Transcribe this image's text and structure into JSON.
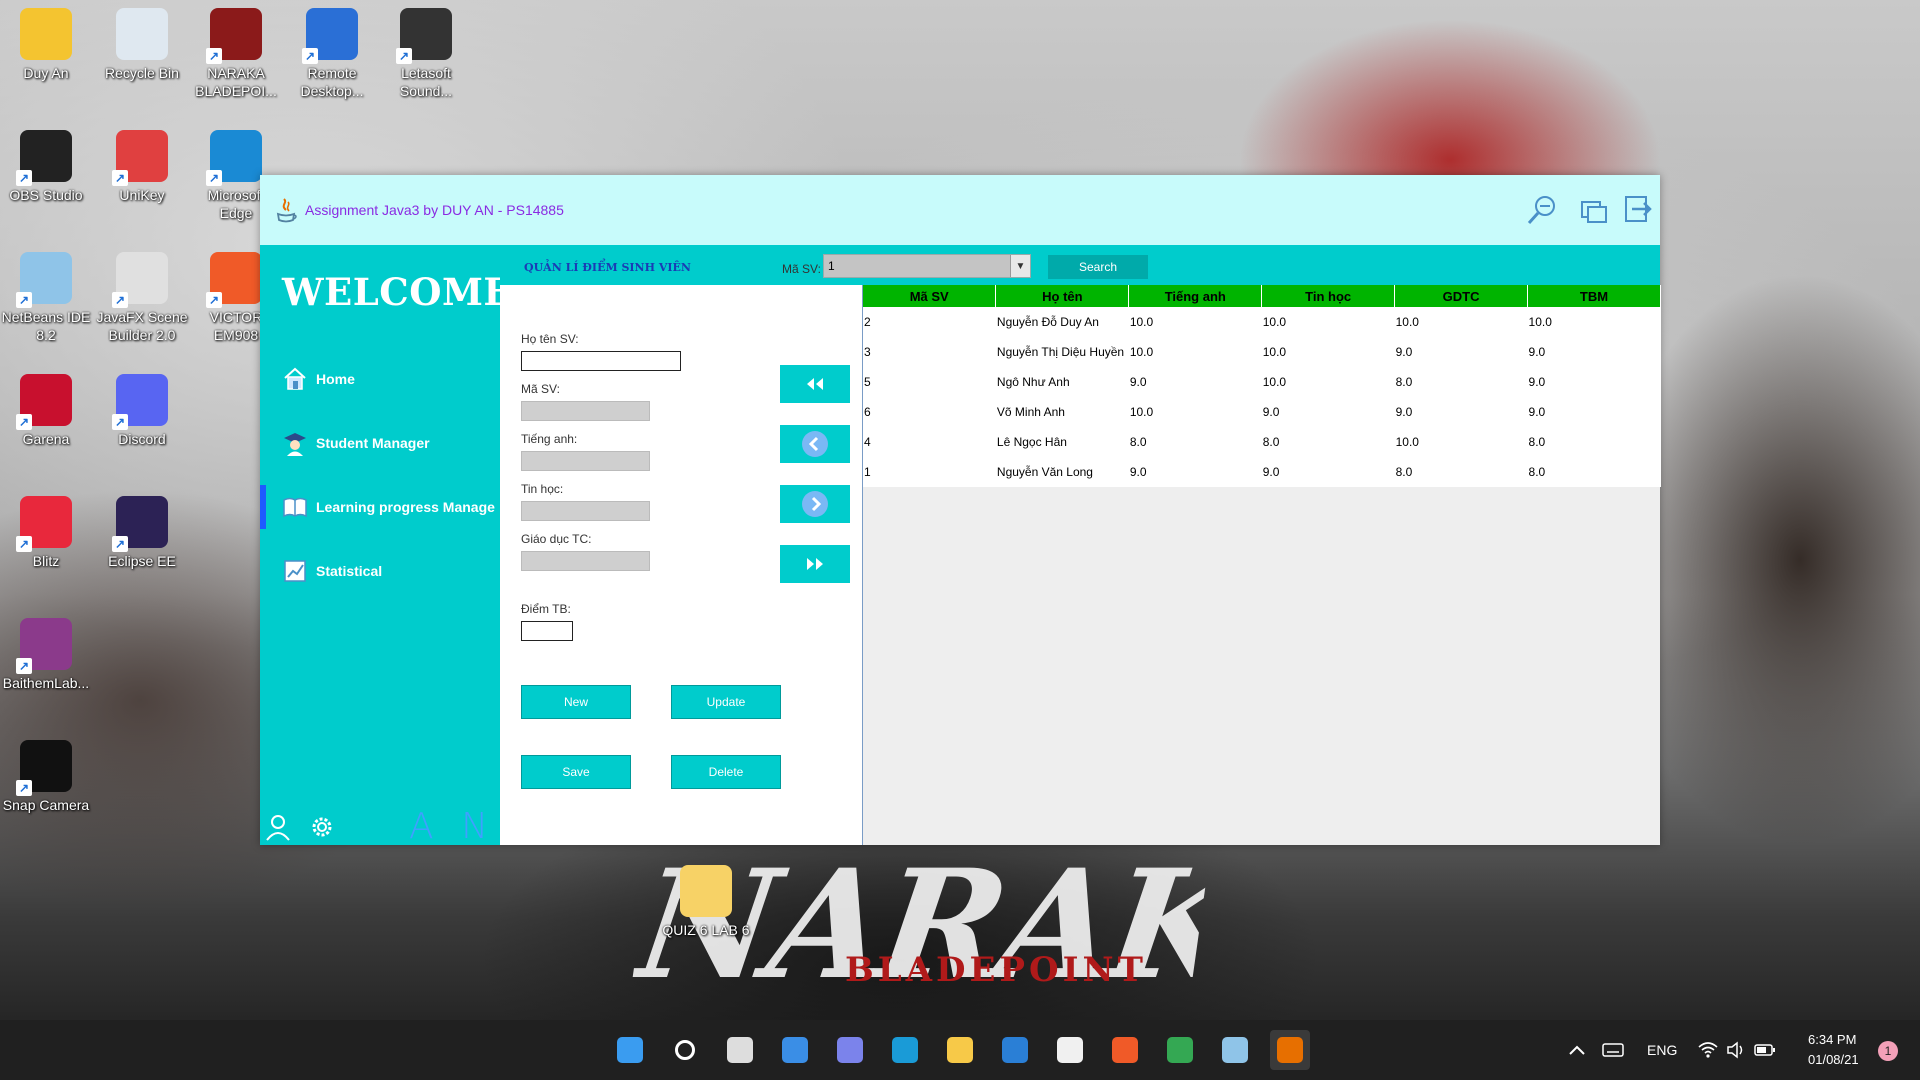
{
  "desktop": {
    "icons": [
      {
        "label": "Duy An",
        "icon": "user-folder-icon",
        "color": "#f4c430"
      },
      {
        "label": "Recycle Bin",
        "icon": "recycle-bin-icon",
        "color": "#dfe8f0"
      },
      {
        "label": "NARAKA BLADEPOI...",
        "icon": "naraka-game-icon",
        "color": "#8b1a1a"
      },
      {
        "label": "Remote Desktop...",
        "icon": "remote-desktop-icon",
        "color": "#2a6fd6"
      },
      {
        "label": "Letasoft Sound...",
        "icon": "speaker-icon",
        "color": "#333333"
      },
      {
        "label": "OBS Studio",
        "icon": "obs-icon",
        "color": "#222222"
      },
      {
        "label": "UniKey",
        "icon": "unikey-icon",
        "color": "#e04040"
      },
      {
        "label": "Microsoft Edge",
        "icon": "edge-icon",
        "color": "#1a8ad4"
      },
      {
        "label": "NetBeans IDE 8.2",
        "icon": "netbeans-icon",
        "color": "#8fc4e8"
      },
      {
        "label": "JavaFX Scene Builder 2.0",
        "icon": "hand-cursor-icon",
        "color": "#e0e0e0"
      },
      {
        "label": "VICTOR EM908",
        "icon": "victor-icon",
        "color": "#f05a28"
      },
      {
        "label": "Garena",
        "icon": "garena-icon",
        "color": "#c8102e"
      },
      {
        "label": "Discord",
        "icon": "discord-icon",
        "color": "#5865f2"
      },
      {
        "label": "Blitz",
        "icon": "blitz-icon",
        "color": "#e8283c"
      },
      {
        "label": "Eclipse EE",
        "icon": "eclipse-icon",
        "color": "#2c2255"
      },
      {
        "label": "BaithemLab...",
        "icon": "winrar-icon",
        "color": "#8b3a8b"
      },
      {
        "label": "Snap Camera",
        "icon": "snap-camera-icon",
        "color": "#111111"
      },
      {
        "label": "QUIZ 6 LAB 6",
        "icon": "folder-icon",
        "color": "#f7d266"
      }
    ],
    "wallpaper_title": "NARAKA",
    "wallpaper_subtitle": "BLADEPOINT"
  },
  "window": {
    "title": "Assignment Java3 by DUY AN - PS14885",
    "title_color": "#8a2be2",
    "titlebar_color": "#c8fbfb",
    "accent": "#00cccc",
    "titlebar_buttons": [
      "zoom-out-icon",
      "restore-window-icon",
      "exit-icon"
    ]
  },
  "sidebar": {
    "welcome": "WELCOME",
    "items": [
      {
        "label": "Home",
        "icon": "home-icon",
        "active": false
      },
      {
        "label": "Student Manager",
        "icon": "student-icon",
        "active": false
      },
      {
        "label": "Learning progress Manage",
        "icon": "book-icon",
        "active": true
      },
      {
        "label": "Statistical",
        "icon": "chart-icon",
        "active": false
      }
    ],
    "footer_text": "A N"
  },
  "header": {
    "module_title": "QUẢN LÍ ĐIỂM SINH VIÊN",
    "masv_label": "Mã SV:",
    "masv_selected": "1",
    "search_label": "Search"
  },
  "form": {
    "hoten_label": "Họ tên SV:",
    "hoten_value": "",
    "masv_label": "Mã SV:",
    "tienganh_label": "Tiếng anh:",
    "tinhoc_label": "Tin học:",
    "gdtc_label": "Giáo dục TC:",
    "diemtb_label": "Điểm TB:",
    "diemtb_value": "",
    "buttons": {
      "new": "New",
      "update": "Update",
      "save": "Save",
      "delete": "Delete"
    },
    "nav_buttons": [
      "first-record-icon",
      "previous-record-icon",
      "next-record-icon",
      "last-record-icon"
    ]
  },
  "table": {
    "header_color": "#00b400",
    "columns": [
      "Mã SV",
      "Họ tên",
      "Tiếng anh",
      "Tin học",
      "GDTC",
      "TBM"
    ],
    "rows": [
      [
        "2",
        "Nguyễn Đỗ Duy An",
        "10.0",
        "10.0",
        "10.0",
        "10.0"
      ],
      [
        "3",
        "Nguyễn Thị Diệu Huyền",
        "10.0",
        "10.0",
        "9.0",
        "9.0"
      ],
      [
        "5",
        "Ngô Như Anh",
        "9.0",
        "10.0",
        "8.0",
        "9.0"
      ],
      [
        "6",
        "Võ Minh Anh",
        "10.0",
        "9.0",
        "9.0",
        "9.0"
      ],
      [
        "4",
        "Lê Ngọc Hân",
        "8.0",
        "8.0",
        "10.0",
        "8.0"
      ],
      [
        "1",
        "Nguyễn Văn Long",
        "9.0",
        "9.0",
        "8.0",
        "8.0"
      ]
    ]
  },
  "taskbar": {
    "apps": [
      "windows-start-icon",
      "search-icon",
      "task-view-icon",
      "widgets-icon",
      "teams-chat-icon",
      "edge-icon",
      "file-explorer-icon",
      "mail-icon",
      "store-icon",
      "victor-icon",
      "chrome-icon",
      "netbeans-icon",
      "java-icon"
    ],
    "language": "ENG",
    "time": "6:34 PM",
    "date": "01/08/21",
    "notifications": "1"
  }
}
